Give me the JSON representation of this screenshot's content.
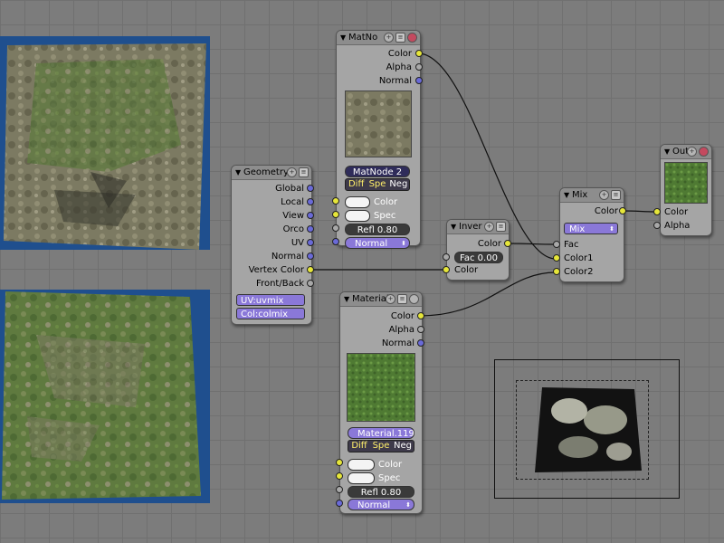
{
  "nodes": {
    "matno": {
      "title": "MatNo",
      "outputs": [
        "Color",
        "Alpha",
        "Normal"
      ],
      "material_name": "MatNode",
      "material_users": "2",
      "flags": [
        "Diff",
        "Spe",
        "Neg"
      ],
      "inputs": [
        "Color",
        "Spec"
      ],
      "refl": "Refl 0.80",
      "normal": "Normal"
    },
    "geometry": {
      "title": "Geometry",
      "outputs": [
        "Global",
        "Local",
        "View",
        "Orco",
        "UV",
        "Normal",
        "Vertex Color",
        "Front/Back"
      ],
      "uv_field": "UV:uvmix",
      "col_field": "Col:colmix"
    },
    "invert": {
      "title": "Inver",
      "output": "Color",
      "fac": "Fac 0.00",
      "input": "Color"
    },
    "mix": {
      "title": "Mix",
      "output": "Color",
      "mode": "Mix",
      "inputs": [
        "Fac",
        "Color1",
        "Color2"
      ]
    },
    "output": {
      "title": "Out",
      "inputs": [
        "Color",
        "Alpha"
      ]
    },
    "material": {
      "title": "Material",
      "outputs": [
        "Color",
        "Alpha",
        "Normal"
      ],
      "material_name": "Material.119",
      "flags": [
        "Diff",
        "Spe",
        "Neg"
      ],
      "inputs": [
        "Color",
        "Spec"
      ],
      "refl": "Refl 0.80",
      "normal": "Normal"
    }
  },
  "colors": {
    "socket_color": "#e6e63a",
    "socket_value": "#a8a8a8",
    "socket_vector": "#6a6ad8",
    "node_bg": "#a5a5a5",
    "preview_bg": "#1f4f8e"
  }
}
